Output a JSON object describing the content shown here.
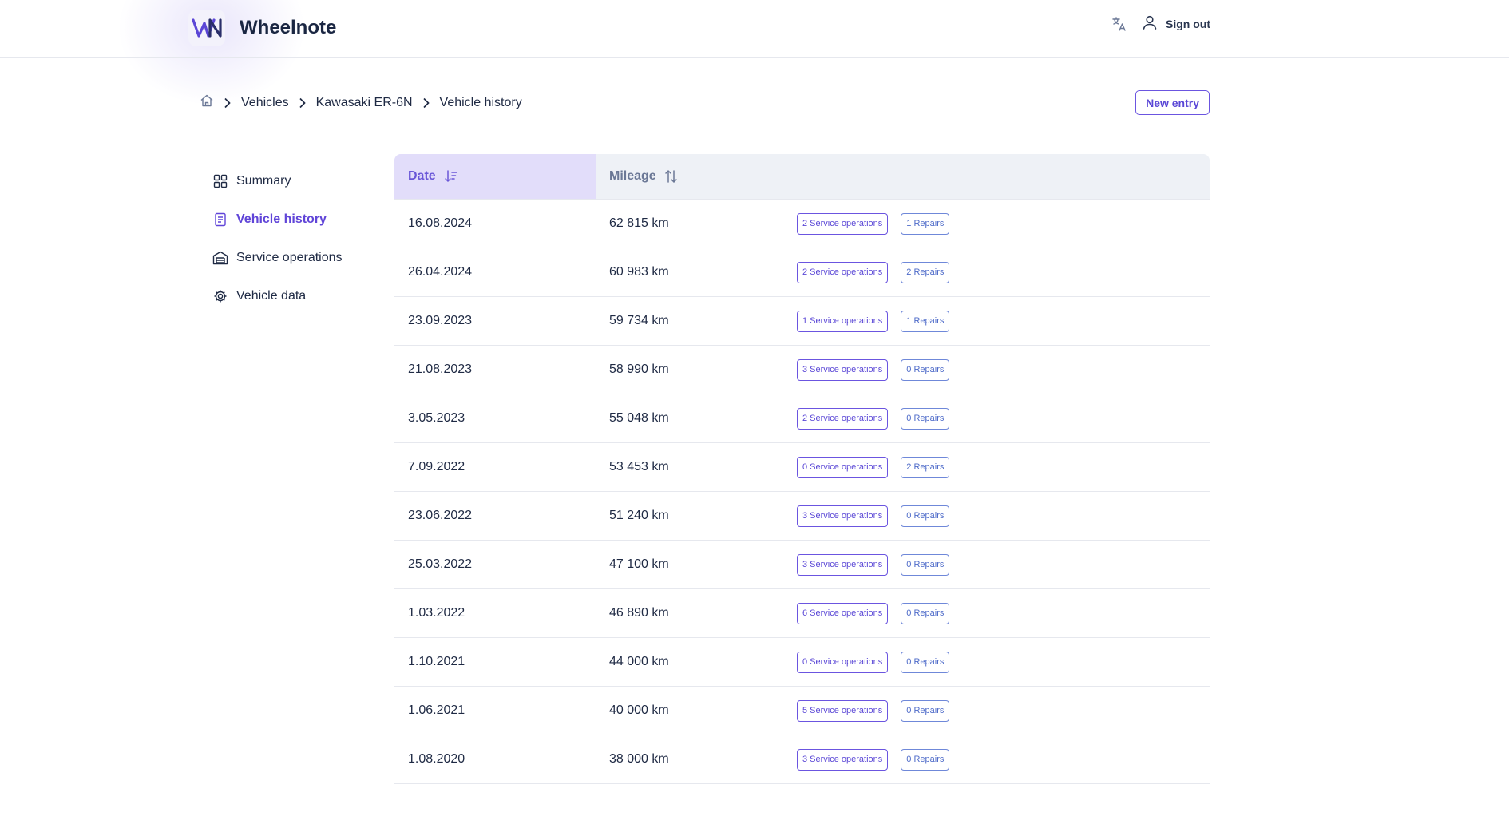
{
  "app": {
    "name": "Wheelnote"
  },
  "header": {
    "sign_out_label": "Sign out"
  },
  "breadcrumb": [
    {
      "label": "Vehicles"
    },
    {
      "label": "Kawasaki ER-6N"
    },
    {
      "label": "Vehicle history"
    }
  ],
  "actions": {
    "new_entry_label": "New entry"
  },
  "sidebar": {
    "items": [
      {
        "label": "Summary",
        "icon": "grid-icon",
        "active": false
      },
      {
        "label": "Vehicle history",
        "icon": "document-icon",
        "active": true
      },
      {
        "label": "Service operations",
        "icon": "garage-icon",
        "active": false
      },
      {
        "label": "Vehicle data",
        "icon": "gear-icon",
        "active": false
      }
    ]
  },
  "table": {
    "columns": [
      {
        "label": "Date",
        "sort": "descending"
      },
      {
        "label": "Mileage",
        "sort": "none"
      }
    ],
    "rows": [
      {
        "date": "16.08.2024",
        "mileage": "62 815 km",
        "service": "2 Service operations",
        "repairs": "1 Repairs"
      },
      {
        "date": "26.04.2024",
        "mileage": "60 983 km",
        "service": "2 Service operations",
        "repairs": "2 Repairs"
      },
      {
        "date": "23.09.2023",
        "mileage": "59 734 km",
        "service": "1 Service operations",
        "repairs": "1 Repairs"
      },
      {
        "date": "21.08.2023",
        "mileage": "58 990 km",
        "service": "3 Service operations",
        "repairs": "0 Repairs"
      },
      {
        "date": "3.05.2023",
        "mileage": "55 048 km",
        "service": "2 Service operations",
        "repairs": "0 Repairs"
      },
      {
        "date": "7.09.2022",
        "mileage": "53 453 km",
        "service": "0 Service operations",
        "repairs": "2 Repairs"
      },
      {
        "date": "23.06.2022",
        "mileage": "51 240 km",
        "service": "3 Service operations",
        "repairs": "0 Repairs"
      },
      {
        "date": "25.03.2022",
        "mileage": "47 100 km",
        "service": "3 Service operations",
        "repairs": "0 Repairs"
      },
      {
        "date": "1.03.2022",
        "mileage": "46 890 km",
        "service": "6 Service operations",
        "repairs": "0 Repairs"
      },
      {
        "date": "1.10.2021",
        "mileage": "44 000 km",
        "service": "0 Service operations",
        "repairs": "0 Repairs"
      },
      {
        "date": "1.06.2021",
        "mileage": "40 000 km",
        "service": "5 Service operations",
        "repairs": "0 Repairs"
      },
      {
        "date": "1.08.2020",
        "mileage": "38 000 km",
        "service": "3 Service operations",
        "repairs": "0 Repairs"
      }
    ]
  },
  "colors": {
    "accent": "#6045d8",
    "header_active_bg": "#e2ddfa",
    "table_header_bg": "#eef1f6"
  }
}
